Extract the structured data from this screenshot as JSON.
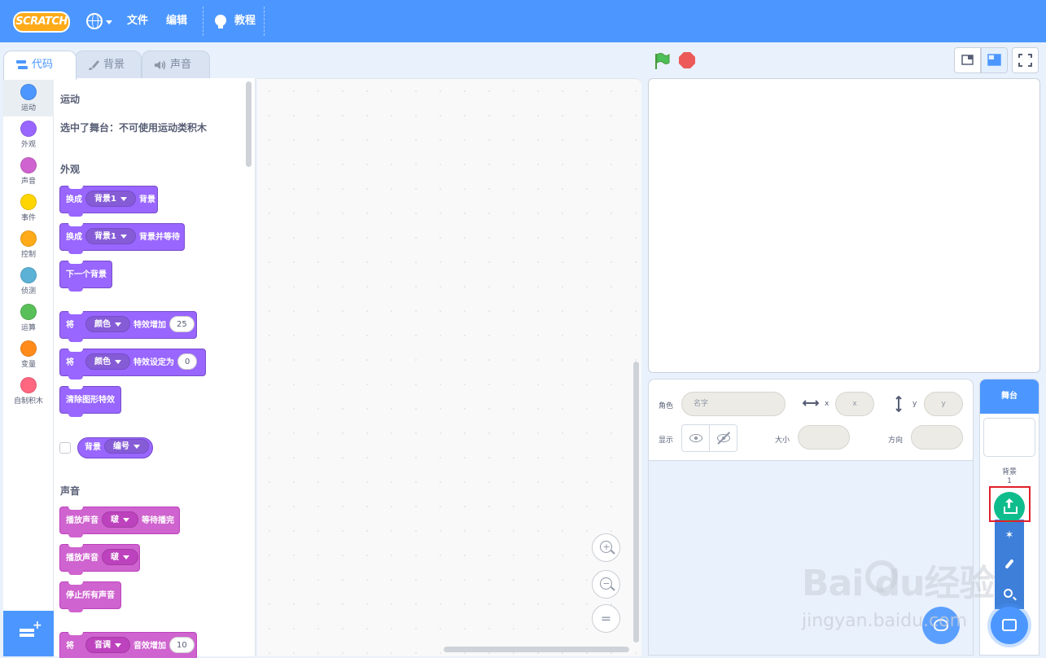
{
  "menubar": {
    "logo": "SCRATCH",
    "file": "文件",
    "edit": "编辑",
    "tutorials": "教程"
  },
  "tabs": [
    {
      "label": "代码",
      "icon": "code-icon",
      "active": true
    },
    {
      "label": "背景",
      "icon": "brush-icon",
      "active": false
    },
    {
      "label": "声音",
      "icon": "speaker-icon",
      "active": false
    }
  ],
  "categories": [
    {
      "label": "运动",
      "color": "#4c97ff"
    },
    {
      "label": "外观",
      "color": "#9966ff"
    },
    {
      "label": "声音",
      "color": "#cf63cf"
    },
    {
      "label": "事件",
      "color": "#ffd500"
    },
    {
      "label": "控制",
      "color": "#ffab19"
    },
    {
      "label": "侦测",
      "color": "#5cb1d6"
    },
    {
      "label": "运算",
      "color": "#59c059"
    },
    {
      "label": "变量",
      "color": "#ff8c1a"
    },
    {
      "label": "自制积木",
      "color": "#ff6680"
    }
  ],
  "palette": {
    "motion_title": "运动",
    "motion_note": "选中了舞台：不可使用运动类积木",
    "looks_title": "外观",
    "looks_blocks": {
      "switch_bg": {
        "pre": "换成",
        "menu": "背景1",
        "post": "背景"
      },
      "switch_bg_wait": {
        "pre": "换成",
        "menu": "背景1",
        "post": "背景并等待"
      },
      "next_bg": "下一个背景",
      "change_effect": {
        "pre": "将",
        "menu": "颜色",
        "mid": "特效增加",
        "value": "25"
      },
      "set_effect": {
        "pre": "将",
        "menu": "颜色",
        "mid": "特效设定为",
        "value": "0"
      },
      "clear_effects": "清除图形特效",
      "bg_reporter": {
        "label": "背景",
        "menu": "编号"
      }
    },
    "sound_title": "声音",
    "sound_blocks": {
      "play_until_done": {
        "pre": "播放声音",
        "menu": "啵",
        "post": "等待播完"
      },
      "start_sound": {
        "pre": "播放声音",
        "menu": "啵"
      },
      "stop_all": "停止所有声音",
      "change_effect": {
        "pre": "将",
        "menu": "音调",
        "mid": "音效增加",
        "value": "10"
      }
    }
  },
  "zoom": {
    "reset_symbol": "="
  },
  "sprite_info": {
    "sprite_label": "角色",
    "name_placeholder": "名字",
    "x_label": "x",
    "x_placeholder": "x",
    "y_label": "y",
    "y_placeholder": "y",
    "show_label": "显示",
    "size_label": "大小",
    "direction_label": "方向"
  },
  "target_pane": {
    "stage_label": "舞台",
    "backdrops_label": "背景",
    "backdrops_count": "1"
  },
  "watermark": {
    "main": "Bai du经验",
    "sub": "jingyan.baidu.com"
  },
  "colors": {
    "menubar": "#4c97ff",
    "looks": "#9966ff",
    "sound": "#cf63cf",
    "upload": "#0fbd8c",
    "highlight": "#e0202a"
  }
}
